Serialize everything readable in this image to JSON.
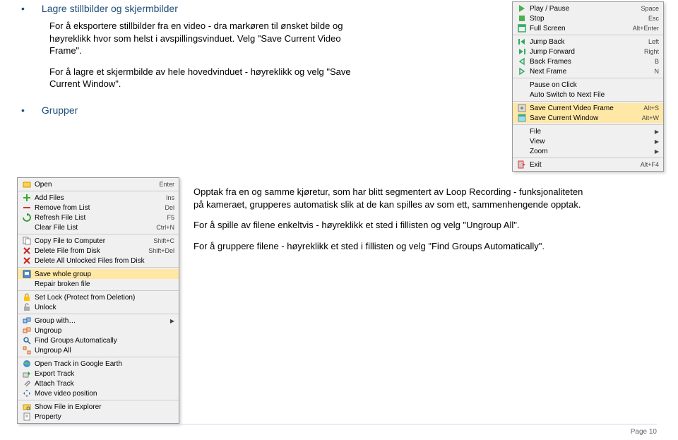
{
  "section1": {
    "heading": "Lagre stillbilder og skjermbilder",
    "p1": "For å eksportere stillbilder fra en video - dra markøren til ønsket bilde og høyreklikk hvor som helst i avspillingsvinduet. Velg \"Save Current Video Frame\".",
    "p2": "For å lagre et skjermbilde av hele hovedvinduet - høyreklikk og velg \"Save Current Window\"."
  },
  "section2": {
    "heading": "Grupper",
    "p1": "Opptak fra en og samme kjøretur, som har blitt segmentert av Loop Recording - funksjonaliteten på kameraet, grupperes automatisk slik at de kan spilles av som ett, sammenhengende opptak.",
    "p2": "For å spille av filene enkeltvis - høyreklikk et sted i fillisten og velg \"Ungroup All\".",
    "p3": "For å gruppere filene - høyreklikk et sted i fillisten og velg \"Find Groups Automatically\"."
  },
  "menuRight": [
    {
      "label": "Play / Pause",
      "key": "Space",
      "icon": "play"
    },
    {
      "label": "Stop",
      "key": "Esc",
      "icon": "stop"
    },
    {
      "label": "Full Screen",
      "key": "Alt+Enter",
      "icon": "fullscreen"
    },
    {
      "sep": true
    },
    {
      "label": "Jump Back",
      "key": "Left",
      "icon": "back"
    },
    {
      "label": "Jump Forward",
      "key": "Right",
      "icon": "forward"
    },
    {
      "label": "Back Frames",
      "key": "B",
      "icon": "backframe"
    },
    {
      "label": "Next Frame",
      "key": "N",
      "icon": "nextframe"
    },
    {
      "sep": true
    },
    {
      "label": "Pause on Click",
      "key": "",
      "icon": ""
    },
    {
      "label": "Auto Switch to Next File",
      "key": "",
      "icon": ""
    },
    {
      "sep": true
    },
    {
      "label": "Save Current Video Frame",
      "key": "Alt+S",
      "icon": "saveframe",
      "hl": true
    },
    {
      "label": "Save Current Window",
      "key": "Alt+W",
      "icon": "savewin",
      "hl": true
    },
    {
      "sep": true
    },
    {
      "label": "File",
      "arrow": true,
      "icon": ""
    },
    {
      "label": "View",
      "arrow": true,
      "icon": ""
    },
    {
      "label": "Zoom",
      "arrow": true,
      "icon": ""
    },
    {
      "sep": true
    },
    {
      "label": "Exit",
      "key": "Alt+F4",
      "icon": "exit"
    }
  ],
  "menuLeft": [
    {
      "label": "Open",
      "key": "Enter",
      "icon": "open"
    },
    {
      "sep": true
    },
    {
      "label": "Add Files",
      "key": "Ins",
      "icon": "add"
    },
    {
      "label": "Remove from List",
      "key": "Del",
      "icon": "remove"
    },
    {
      "label": "Refresh File List",
      "key": "F5",
      "icon": "refresh"
    },
    {
      "label": "Clear File List",
      "key": "Ctrl+N",
      "icon": ""
    },
    {
      "sep": true
    },
    {
      "label": "Copy File to Computer",
      "key": "Shift+C",
      "icon": "copy"
    },
    {
      "label": "Delete File from Disk",
      "key": "Shift+Del",
      "icon": "delete"
    },
    {
      "label": "Delete All Unlocked Files from Disk",
      "key": "",
      "icon": "deleteall"
    },
    {
      "sep": true
    },
    {
      "label": "Save whole group",
      "key": "",
      "icon": "savegroup",
      "hl": true
    },
    {
      "label": "Repair broken file",
      "key": "",
      "icon": ""
    },
    {
      "sep": true
    },
    {
      "label": "Set Lock (Protect from Deletion)",
      "key": "",
      "icon": "lock"
    },
    {
      "label": "Unlock",
      "key": "",
      "icon": "unlock"
    },
    {
      "sep": true
    },
    {
      "label": "Group with…",
      "arrow": true,
      "icon": "group"
    },
    {
      "label": "Ungroup",
      "key": "",
      "icon": "ungroup"
    },
    {
      "label": "Find Groups Automatically",
      "key": "",
      "icon": "findgroup"
    },
    {
      "label": "Ungroup All",
      "key": "",
      "icon": "ungroupall"
    },
    {
      "sep": true
    },
    {
      "label": "Open Track in Google Earth",
      "key": "",
      "icon": "earth"
    },
    {
      "label": "Export Track",
      "key": "",
      "icon": "export"
    },
    {
      "label": "Attach Track",
      "key": "",
      "icon": "attach"
    },
    {
      "label": "Move video position",
      "key": "",
      "icon": "move"
    },
    {
      "sep": true
    },
    {
      "label": "Show File in Explorer",
      "key": "",
      "icon": "showfile"
    },
    {
      "label": "Property",
      "key": "",
      "icon": "property"
    }
  ],
  "pageNumber": "Page 10"
}
